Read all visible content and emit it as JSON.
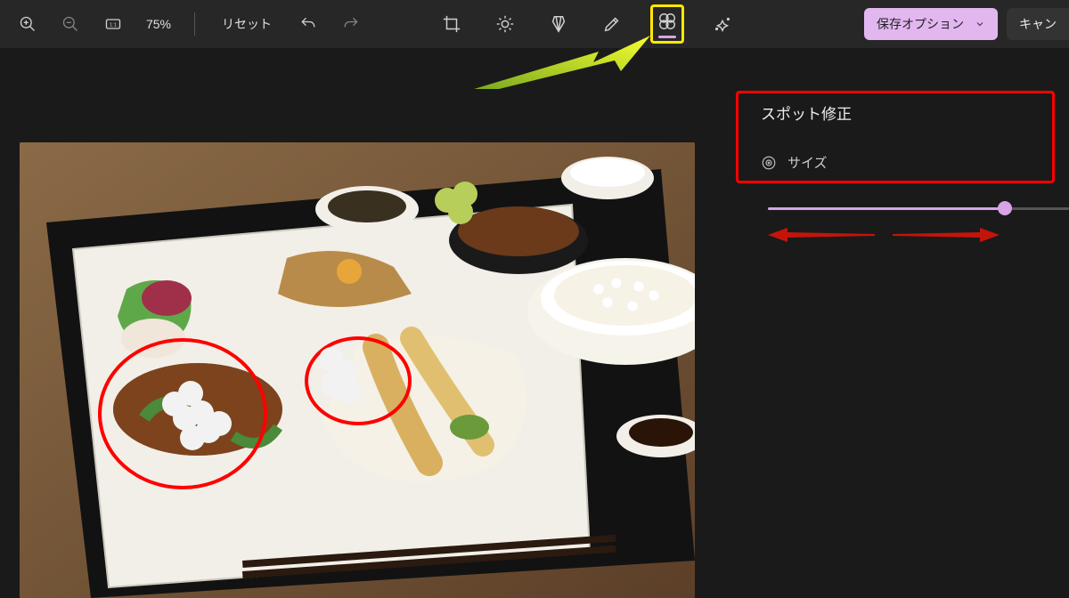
{
  "toolbar": {
    "zoom_percent": "75%",
    "reset_label": "リセット",
    "tools": {
      "crop": "crop-icon",
      "adjust": "adjust-icon",
      "filter": "filter-icon",
      "markup": "markup-icon",
      "retouch": "retouch-icon",
      "effects": "effects-icon"
    },
    "save_options_label": "保存オプション",
    "cancel_label": "キャン"
  },
  "panel": {
    "title": "スポット修正",
    "size_label": "サイズ",
    "slider_value": 78
  },
  "colors": {
    "accent": "#d9a3e8",
    "highlight": "#ffe900",
    "annotation": "#ff0000"
  }
}
